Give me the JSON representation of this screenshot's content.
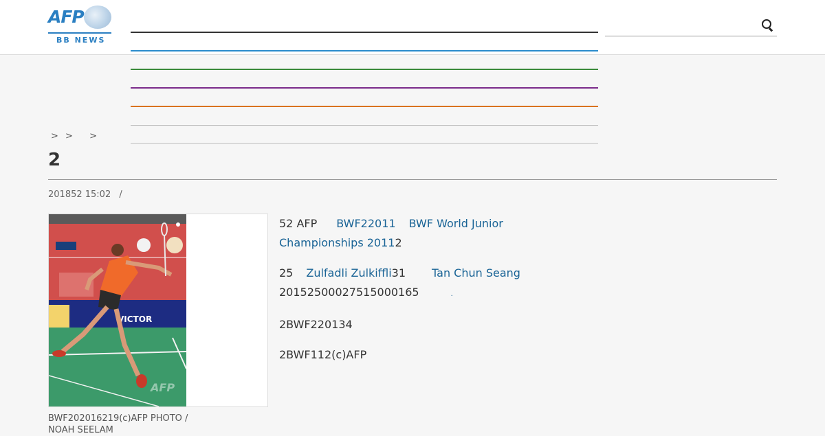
{
  "header": {
    "logo_text": "AFP",
    "logo_sub": "BB NEWS",
    "nav_colors": [
      "#333333",
      "#2a8ccc",
      "#3a8a3a",
      "#7a2a8a",
      "#d9731f",
      "#bbbbbb",
      "#bbbbbb"
    ],
    "search_placeholder": ""
  },
  "breadcrumb": [
    ">",
    ">",
    ">"
  ],
  "article": {
    "title": "2",
    "meta_date": "201852 15:02",
    "meta_sep": "/",
    "caption": "BWF202016219(c)AFP PHOTO / NOAH SEELAM",
    "p1": {
      "t1": "52 AFP",
      "link1": "BWF22011",
      "link2": "BWF World Junior Championships 2011",
      "t2": "2"
    },
    "p2": {
      "t1": "25",
      "link1": "Zulfadli Zulkiffli",
      "t2": "31",
      "link2": "Tan Chun Seang",
      "t3": "20152500027515000165",
      "t4": "."
    },
    "p3": "2BWF220134",
    "p4": "2BWF112(c)AFP"
  }
}
